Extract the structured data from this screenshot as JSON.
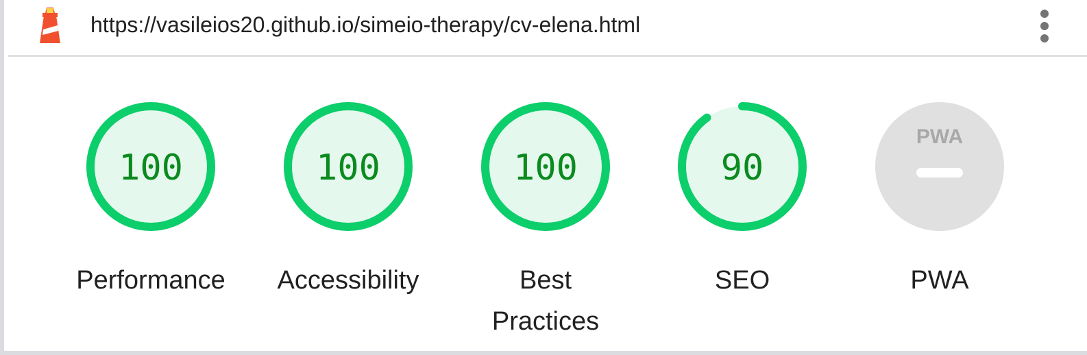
{
  "header": {
    "url": "https://vasileios20.github.io/simeio-therapy/cv-elena.html",
    "logo_icon": "lighthouse-icon",
    "menu_icon": "more-vert-icon"
  },
  "colors": {
    "pass_green": "#0cce6b",
    "pass_fill": "#e5f8ee",
    "score_text": "#0b8a1e",
    "pwa_gray": "#e0e0e0"
  },
  "gauges": [
    {
      "label": "Performance",
      "score": "100",
      "score_value": 100
    },
    {
      "label": "Accessibility",
      "score": "100",
      "score_value": 100
    },
    {
      "label": "Best Practices",
      "label_line1": "Best",
      "label_line2": "Practices",
      "score": "100",
      "score_value": 100
    },
    {
      "label": "SEO",
      "score": "90",
      "score_value": 90
    },
    {
      "label": "PWA",
      "badge_text": "PWA",
      "icon": "pwa-badge-icon"
    }
  ]
}
